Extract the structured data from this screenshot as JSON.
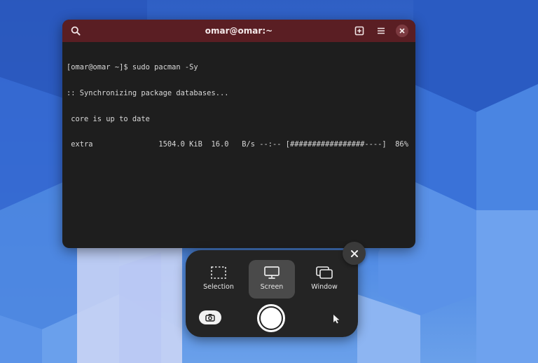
{
  "terminal": {
    "title": "omar@omar:~",
    "lines": [
      "[omar@omar ~]$ sudo pacman -Sy",
      ":: Synchronizing package databases...",
      " core is up to date",
      " extra               1504.0 KiB  16.0   B/s --:-- [#################----]  86%"
    ],
    "icons": {
      "search": "search-icon",
      "new_tab": "new-tab-icon",
      "menu": "hamburger-menu-icon",
      "close": "close-icon"
    }
  },
  "screenshot_ui": {
    "modes": [
      {
        "label": "Selection",
        "icon": "selection-icon",
        "selected": false
      },
      {
        "label": "Screen",
        "icon": "monitor-icon",
        "selected": true
      },
      {
        "label": "Window",
        "icon": "window-icon",
        "selected": false
      }
    ],
    "capture_icon": "capture-button",
    "photo_icon": "camera-icon",
    "pointer_icon": "pointer-icon",
    "close_icon": "close-icon"
  },
  "colors": {
    "header": "#5a1e23",
    "terminal_bg": "#1e1e1e",
    "panel_bg": "#242424",
    "selected_mode_bg": "#4a4a4a"
  }
}
